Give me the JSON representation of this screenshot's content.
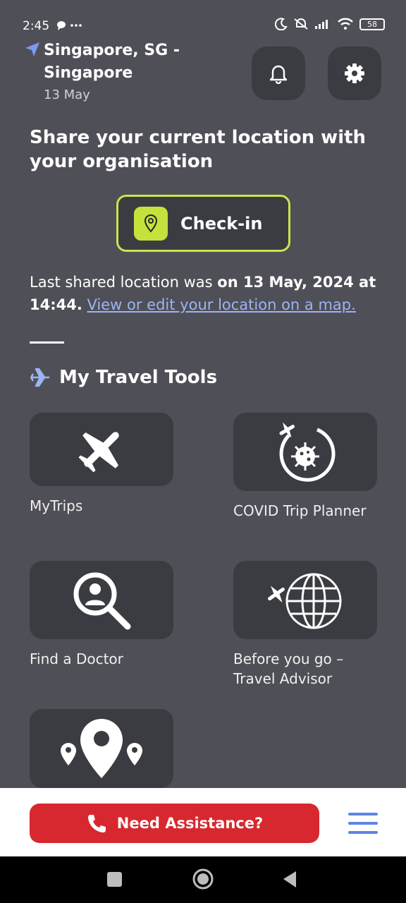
{
  "status_bar": {
    "time": "2:45",
    "left_icons": "• ···",
    "battery": "58"
  },
  "location": {
    "city_line": "Singapore, SG - Singapore",
    "date": "13 May"
  },
  "share": {
    "title": "Share your current location with your organisation",
    "checkin_label": "Check-in",
    "last_shared_prefix": "Last shared location was ",
    "last_shared_bold": "on 13 May, 2024 at 14:44.",
    "map_link": "View or edit your location on a map."
  },
  "tools": {
    "title": "My Travel Tools",
    "items": [
      {
        "label": "MyTrips",
        "icon": "airplane-icon"
      },
      {
        "label": "COVID Trip Planner",
        "icon": "covid-virus-icon"
      },
      {
        "label": "Find a Doctor",
        "icon": "doctor-search-icon"
      },
      {
        "label": "Before you go – Travel Advisor",
        "icon": "globe-plane-icon"
      },
      {
        "label": "",
        "icon": "map-pins-icon"
      }
    ]
  },
  "bottom": {
    "assist_label": "Need Assistance?"
  },
  "colors": {
    "background": "#4f4f57",
    "card": "#3b3c42",
    "accent_lime": "#c3e23c",
    "assist_red": "#d7282f",
    "link_blue": "#9db3f5",
    "menu_blue": "#5d84e6"
  }
}
